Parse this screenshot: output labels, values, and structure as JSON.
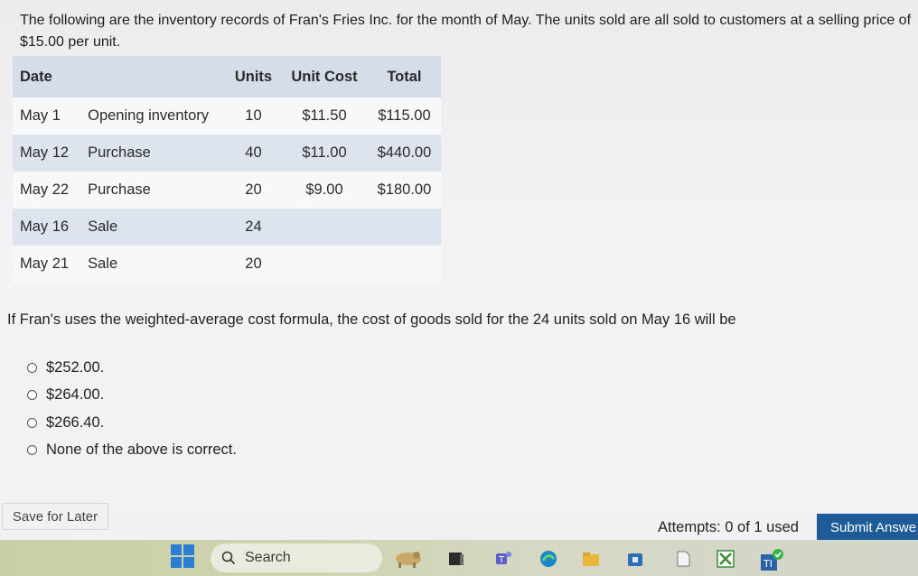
{
  "intro_text": "The following are the inventory records of Fran's Fries Inc. for the month of May. The units sold are all sold to customers at a selling price of $15.00 per unit.",
  "table": {
    "headers": {
      "date": "Date",
      "units": "Units",
      "unit_cost": "Unit Cost",
      "total": "Total"
    },
    "rows": [
      {
        "date": "May 1",
        "desc": "Opening inventory",
        "units": "10",
        "unit_cost": "$11.50",
        "total": "$115.00"
      },
      {
        "date": "May 12",
        "desc": "Purchase",
        "units": "40",
        "unit_cost": "$11.00",
        "total": "$440.00"
      },
      {
        "date": "May 22",
        "desc": "Purchase",
        "units": "20",
        "unit_cost": "$9.00",
        "total": "$180.00"
      },
      {
        "date": "May 16",
        "desc": "Sale",
        "units": "24",
        "unit_cost": "",
        "total": ""
      },
      {
        "date": "May 21",
        "desc": "Sale",
        "units": "20",
        "unit_cost": "",
        "total": ""
      }
    ]
  },
  "question": "If Fran's uses the weighted-average cost formula, the cost of goods sold for the 24 units sold on May 16 will be",
  "options": [
    "$252.00.",
    "$264.00.",
    "$266.40.",
    "None of the above is correct."
  ],
  "footer": {
    "save_label": "Save for Later",
    "attempts_label": "Attempts: 0 of 1 used",
    "submit_label": "Submit Answe"
  },
  "taskbar": {
    "search_label": "Search",
    "icons": [
      "windows-start-icon",
      "search-icon",
      "widget-icon",
      "file-explorer-icon",
      "teams-icon",
      "edge-icon",
      "folder-icon",
      "store-icon",
      "notepad-icon",
      "xbox-icon",
      "app-icon"
    ]
  },
  "colors": {
    "submit_bg": "#1e5c99",
    "header_bg": "#d5dde8",
    "alt_row_bg": "#dde4ee"
  }
}
